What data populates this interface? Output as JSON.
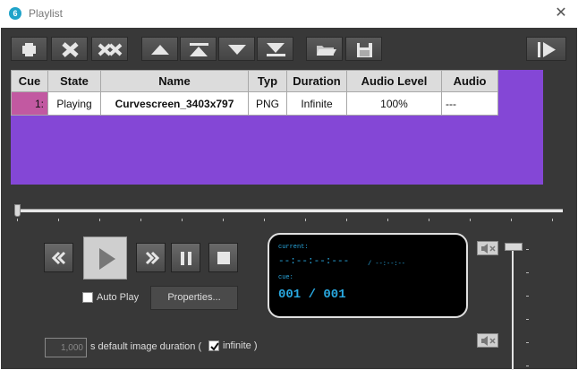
{
  "window": {
    "title": "Playlist",
    "app_icon_glyph": "6",
    "close_glyph": "✕"
  },
  "toolbar": {
    "buttons": [
      {
        "name": "add",
        "icon": "plus-icon"
      },
      {
        "name": "remove",
        "icon": "x-icon"
      },
      {
        "name": "remove-all",
        "icon": "double-x-icon"
      },
      {
        "name": "move-up",
        "icon": "triangle-up-icon"
      },
      {
        "name": "move-top",
        "icon": "move-to-top-icon"
      },
      {
        "name": "move-down",
        "icon": "triangle-down-icon"
      },
      {
        "name": "move-bottom",
        "icon": "move-to-bottom-icon"
      },
      {
        "name": "open",
        "icon": "folder-open-icon"
      },
      {
        "name": "save",
        "icon": "floppy-disk-icon"
      },
      {
        "name": "toggle-panel",
        "icon": "panel-arrow-icon"
      }
    ]
  },
  "playlist": {
    "columns": [
      "Cue",
      "State",
      "Name",
      "Typ",
      "Duration",
      "Audio Level",
      "Audio"
    ],
    "rows": [
      {
        "cue": "1:",
        "state": "Playing",
        "name": "Curvescreen_3403x797",
        "typ": "PNG",
        "duration": "Infinite",
        "audio_level": "100%",
        "audio": "---"
      }
    ]
  },
  "colors": {
    "grid_bg": "#8447d6",
    "cue_cell": "#c259a1",
    "panel_bg": "#383838",
    "display_text": "#29a8e0"
  },
  "transport": {
    "buttons": [
      "rewind-icon",
      "play-icon",
      "fast-forward-icon",
      "pause-icon",
      "stop-icon"
    ]
  },
  "auto_play": {
    "label": "Auto Play",
    "checked": false
  },
  "properties_button": {
    "label": "Properties..."
  },
  "display": {
    "current_label": "current:",
    "current_time": "--:--:--:---",
    "total_time": "/ --:--:--",
    "cue_label": "cue:",
    "cue_value": "001 / 001"
  },
  "volume": {
    "level": 1.0,
    "mute_top_icon": "mute-speaker-icon",
    "mute_bottom_icon": "mute-speaker-icon"
  },
  "duration": {
    "value": "1,000",
    "text": "s default image duration (",
    "infinite_label": "infinite )",
    "infinite_checked": true
  }
}
